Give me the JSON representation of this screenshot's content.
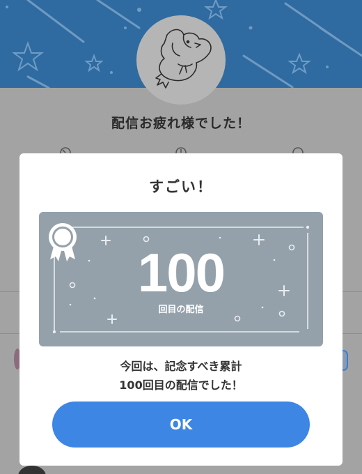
{
  "background": {
    "title": "配信お疲れ様でした！",
    "header_color": "#2f6ba0"
  },
  "modal": {
    "title": "すごい！",
    "badge": {
      "number": "100",
      "label": "回目の配信",
      "card_color": "#94a1ab"
    },
    "message_line1": "今回は、記念すべき累計",
    "message_line2": "100回目の配信でした！",
    "ok_label": "OK",
    "accent_color": "#3d86e4"
  },
  "icons": [
    "star-icon",
    "duck-mascot-icon",
    "clock-icon",
    "timer-icon",
    "speech-bubble-icon",
    "award-ribbon-icon"
  ]
}
